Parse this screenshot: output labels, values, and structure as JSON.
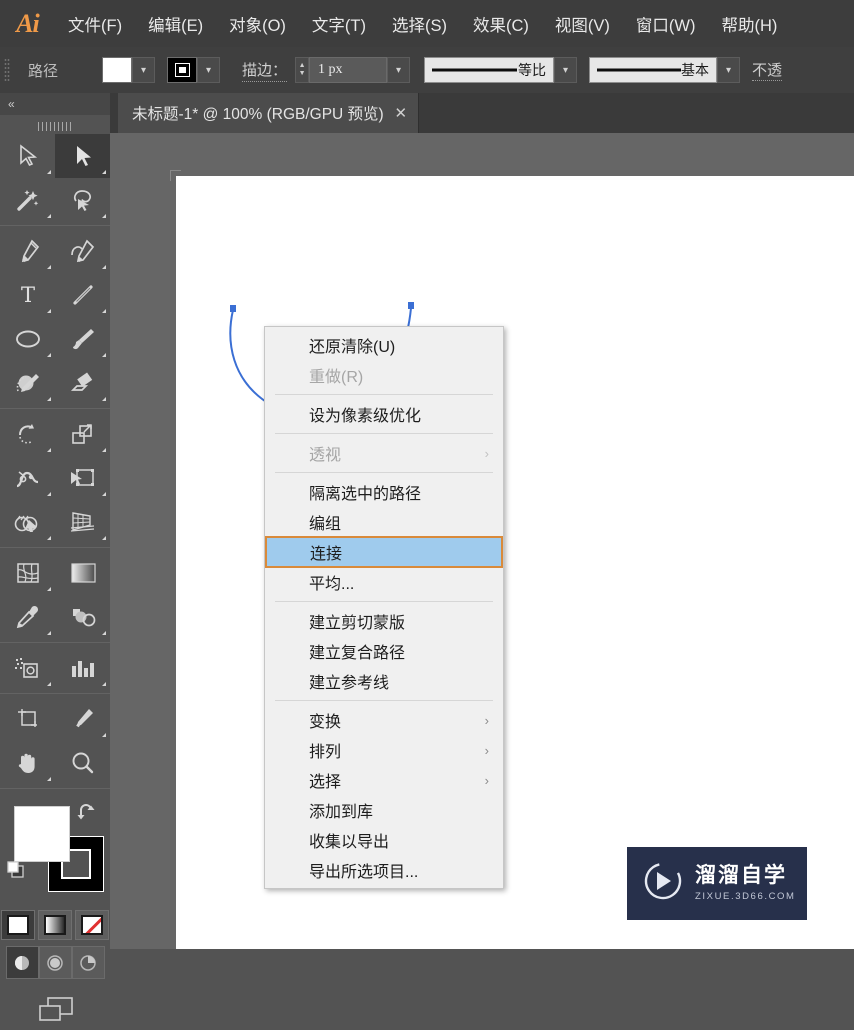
{
  "app": {
    "name": "Ai",
    "logo_color": "#f09a48"
  },
  "menubar": {
    "items": [
      {
        "label": "文件(F)"
      },
      {
        "label": "编辑(E)"
      },
      {
        "label": "对象(O)"
      },
      {
        "label": "文字(T)"
      },
      {
        "label": "选择(S)"
      },
      {
        "label": "效果(C)"
      },
      {
        "label": "视图(V)"
      },
      {
        "label": "窗口(W)"
      },
      {
        "label": "帮助(H)"
      }
    ]
  },
  "controlbar": {
    "selection_label": "路径",
    "fill_color": "#ffffff",
    "stroke_color": "#000000",
    "stroke_label": "描边：",
    "stroke_weight": "1 px",
    "stroke_profile": "等比",
    "brush_definition": "基本",
    "opacity_label": "不透"
  },
  "tabbar": {
    "document_title": "未标题-1* @ 100% (RGB/GPU 预览)",
    "close_label": "✕"
  },
  "toolbar": {
    "collapse_label": "«",
    "tools": [
      {
        "name": "selection-tool",
        "active": false
      },
      {
        "name": "direct-selection-tool",
        "active": true
      },
      {
        "name": "magic-wand-tool",
        "active": false
      },
      {
        "name": "lasso-tool",
        "active": false
      },
      {
        "name": "pen-tool",
        "active": false
      },
      {
        "name": "curvature-tool",
        "active": false
      },
      {
        "name": "type-tool",
        "active": false
      },
      {
        "name": "line-segment-tool",
        "active": false
      },
      {
        "name": "ellipse-tool",
        "active": false
      },
      {
        "name": "paintbrush-tool",
        "active": false
      },
      {
        "name": "shaper-tool",
        "active": false
      },
      {
        "name": "eraser-tool",
        "active": false
      },
      {
        "name": "rotate-tool",
        "active": false
      },
      {
        "name": "scale-tool",
        "active": false
      },
      {
        "name": "width-tool",
        "active": false
      },
      {
        "name": "free-transform-tool",
        "active": false
      },
      {
        "name": "shape-builder-tool",
        "active": false
      },
      {
        "name": "perspective-grid-tool",
        "active": false
      },
      {
        "name": "mesh-tool",
        "active": false
      },
      {
        "name": "gradient-tool",
        "active": false
      },
      {
        "name": "eyedropper-tool",
        "active": false
      },
      {
        "name": "blend-tool",
        "active": false
      },
      {
        "name": "symbol-sprayer-tool",
        "active": false
      },
      {
        "name": "column-graph-tool",
        "active": false
      },
      {
        "name": "artboard-tool",
        "active": false
      },
      {
        "name": "slice-tool",
        "active": false
      },
      {
        "name": "hand-tool",
        "active": false
      },
      {
        "name": "zoom-tool",
        "active": false
      }
    ],
    "fill_stroke": {
      "fill_color": "#ffffff",
      "stroke_color": "#000000"
    },
    "color_modes": [
      {
        "name": "color-mode",
        "selected": true
      },
      {
        "name": "gradient-mode",
        "selected": false
      },
      {
        "name": "none-mode",
        "selected": false
      }
    ],
    "draw_modes": [
      {
        "name": "draw-normal-mode",
        "selected": true
      },
      {
        "name": "draw-behind-mode",
        "selected": false
      },
      {
        "name": "draw-inside-mode",
        "selected": false
      }
    ],
    "screen_mode": {
      "name": "change-screen-mode"
    }
  },
  "context_menu": {
    "items": [
      {
        "label": "还原清除(U)",
        "disabled": false,
        "submenu": false,
        "highlighted": false
      },
      {
        "label": "重做(R)",
        "disabled": true,
        "submenu": false,
        "highlighted": false
      },
      {
        "separator": true
      },
      {
        "label": "设为像素级优化",
        "disabled": false,
        "submenu": false,
        "highlighted": false
      },
      {
        "separator": true
      },
      {
        "label": "透视",
        "disabled": true,
        "submenu": true,
        "highlighted": false
      },
      {
        "separator": true
      },
      {
        "label": "隔离选中的路径",
        "disabled": false,
        "submenu": false,
        "highlighted": false
      },
      {
        "label": "编组",
        "disabled": false,
        "submenu": false,
        "highlighted": false
      },
      {
        "label": "连接",
        "disabled": false,
        "submenu": false,
        "highlighted": true
      },
      {
        "label": "平均...",
        "disabled": false,
        "submenu": false,
        "highlighted": false
      },
      {
        "separator": true
      },
      {
        "label": "建立剪切蒙版",
        "disabled": false,
        "submenu": false,
        "highlighted": false
      },
      {
        "label": "建立复合路径",
        "disabled": false,
        "submenu": false,
        "highlighted": false
      },
      {
        "label": "建立参考线",
        "disabled": false,
        "submenu": false,
        "highlighted": false
      },
      {
        "separator": true
      },
      {
        "label": "变换",
        "disabled": false,
        "submenu": true,
        "highlighted": false
      },
      {
        "label": "排列",
        "disabled": false,
        "submenu": true,
        "highlighted": false
      },
      {
        "label": "选择",
        "disabled": false,
        "submenu": true,
        "highlighted": false
      },
      {
        "label": "添加到库",
        "disabled": false,
        "submenu": false,
        "highlighted": false
      },
      {
        "label": "收集以导出",
        "disabled": false,
        "submenu": false,
        "highlighted": false
      },
      {
        "label": "导出所选项目...",
        "disabled": false,
        "submenu": false,
        "highlighted": false
      }
    ],
    "highlight_bg": "#9fcbed",
    "highlight_border": "#d98a3a",
    "submenu_arrow": "›"
  },
  "canvas": {
    "path_color": "#3b6fd4",
    "anchor_color": "#3b6fd4"
  },
  "watermark": {
    "title": "溜溜自学",
    "subtitle": "ZIXUE.3D66.COM",
    "bg_color": "#27304b"
  }
}
